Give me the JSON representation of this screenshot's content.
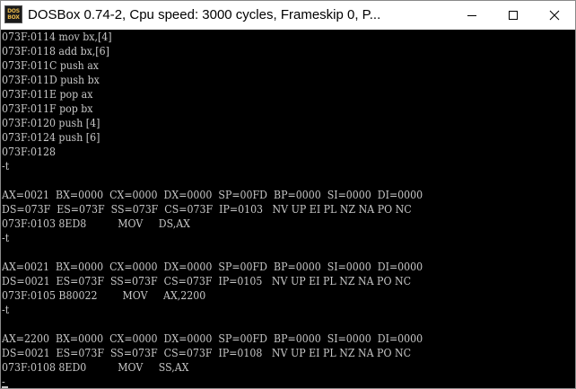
{
  "window": {
    "title": "DOSBox 0.74-2, Cpu speed:     3000 cycles, Frameskip  0, P...",
    "icon_line1": "DOS",
    "icon_line2": "BOX",
    "icon_name": "dosbox-logo-icon",
    "min_icon": "minimize-icon",
    "max_icon": "maximize-icon",
    "close_icon": "close-icon"
  },
  "terminal": {
    "lines": [
      "073F:0114 mov bx,[4]",
      "073F:0118 add bx,[6]",
      "073F:011C push ax",
      "073F:011D push bx",
      "073F:011E pop ax",
      "073F:011F pop bx",
      "073F:0120 push [4]",
      "073F:0124 push [6]",
      "073F:0128",
      "-t",
      "",
      "AX=0021  BX=0000  CX=0000  DX=0000  SP=00FD  BP=0000  SI=0000  DI=0000",
      "DS=073F  ES=073F  SS=073F  CS=073F  IP=0103   NV UP EI PL NZ NA PO NC",
      "073F:0103 8ED8          MOV     DS,AX",
      "-t",
      "",
      "AX=0021  BX=0000  CX=0000  DX=0000  SP=00FD  BP=0000  SI=0000  DI=0000",
      "DS=0021  ES=073F  SS=073F  CS=073F  IP=0105   NV UP EI PL NZ NA PO NC",
      "073F:0105 B80022        MOV     AX,2200",
      "-t",
      "",
      "AX=2200  BX=0000  CX=0000  DX=0000  SP=00FD  BP=0000  SI=0000  DI=0000",
      "DS=0021  ES=073F  SS=073F  CS=073F  IP=0108   NV UP EI PL NZ NA PO NC",
      "073F:0108 8ED0          MOV     SS,AX",
      "-"
    ]
  },
  "colors": {
    "terminal_bg": "#000000",
    "terminal_text": "#c8c8c8",
    "titlebar_bg": "#ffffff"
  }
}
